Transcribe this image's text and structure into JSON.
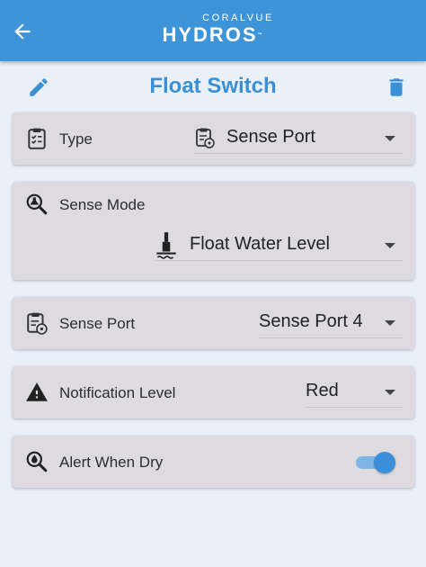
{
  "header": {
    "brand_top": "CORALVUE",
    "brand_main": "HYDROS",
    "brand_tm": "™",
    "back_icon": "arrow-left-icon",
    "bar_color": "#3d94d9"
  },
  "title_bar": {
    "title": "Float Switch",
    "edit_icon": "pencil-icon",
    "delete_icon": "trash-icon",
    "accent_color": "#3a90d6"
  },
  "fields": {
    "type": {
      "label": "Type",
      "icon": "clipboard-icon",
      "value": "Sense Port",
      "value_icon": "clipboard-sensor-icon"
    },
    "sense_mode": {
      "label": "Sense Mode",
      "icon": "flask-search-icon",
      "value": "Float Water Level",
      "value_icon": "float-switch-icon"
    },
    "sense_port": {
      "label": "Sense Port",
      "icon": "clipboard-sensor-icon",
      "value": "Sense Port 4"
    },
    "notification_level": {
      "label": "Notification Level",
      "icon": "alert-triangle-icon",
      "value": "Red"
    },
    "alert_when_dry": {
      "label": "Alert When Dry",
      "icon": "water-search-icon",
      "enabled": true
    }
  }
}
